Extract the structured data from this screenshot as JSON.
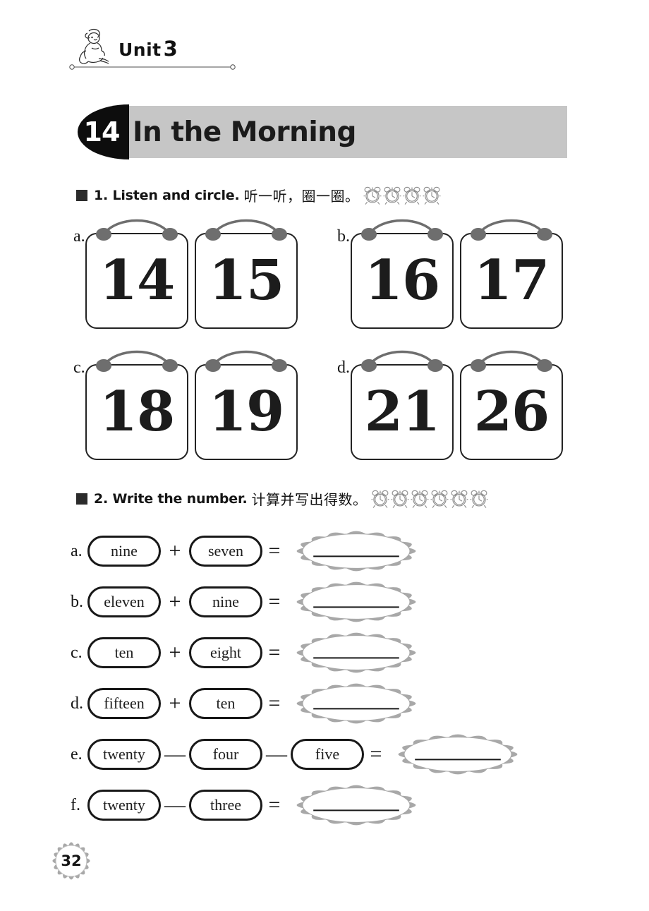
{
  "unit": {
    "label": "Unit",
    "number": "3",
    "mascot_icon": "cartoon-boy-icon"
  },
  "lesson": {
    "number": "14",
    "title": "In the Morning"
  },
  "exercise1": {
    "bullet": "square-bullet",
    "english": "1. Listen and circle.",
    "chinese": "听一听，圈一圈。",
    "clock_count": 4,
    "clock_icon": "alarm-clock-icon",
    "items": [
      {
        "letter": "a.",
        "cards": [
          "14",
          "15"
        ]
      },
      {
        "letter": "b.",
        "cards": [
          "16",
          "17"
        ]
      },
      {
        "letter": "c.",
        "cards": [
          "18",
          "19"
        ]
      },
      {
        "letter": "d.",
        "cards": [
          "21",
          "26"
        ]
      }
    ]
  },
  "exercise2": {
    "bullet": "square-bullet",
    "english": "2. Write the number.",
    "chinese": "计算并写出得数。",
    "clock_count": 6,
    "clock_icon": "alarm-clock-icon",
    "rows": [
      {
        "letter": "a.",
        "operands": [
          "nine",
          "seven"
        ],
        "operators": [
          "+"
        ],
        "equals": "=",
        "answer": ""
      },
      {
        "letter": "b.",
        "operands": [
          "eleven",
          "nine"
        ],
        "operators": [
          "+"
        ],
        "equals": "=",
        "answer": ""
      },
      {
        "letter": "c.",
        "operands": [
          "ten",
          "eight"
        ],
        "operators": [
          "+"
        ],
        "equals": "=",
        "answer": ""
      },
      {
        "letter": "d.",
        "operands": [
          "fifteen",
          "ten"
        ],
        "operators": [
          "+"
        ],
        "equals": "=",
        "answer": ""
      },
      {
        "letter": "e.",
        "operands": [
          "twenty",
          "four",
          "five"
        ],
        "operators": [
          "—",
          "—"
        ],
        "equals": "=",
        "answer": ""
      },
      {
        "letter": "f.",
        "operands": [
          "twenty",
          "three"
        ],
        "operators": [
          "—"
        ],
        "equals": "=",
        "answer": ""
      }
    ]
  },
  "page": {
    "number": "32"
  },
  "colors": {
    "banner_gray": "#c6c6c6",
    "badge_black": "#0d0d0d",
    "cord_gray": "#6e6e6e",
    "burst_gray": "#a8a8a8",
    "ink": "#1a1a1a"
  }
}
